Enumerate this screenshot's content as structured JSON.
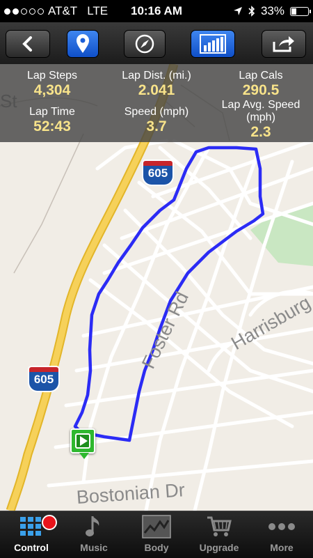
{
  "status_bar": {
    "carrier": "AT&T",
    "network": "LTE",
    "time": "10:16 AM",
    "battery": "33%",
    "battery_level": 0.33,
    "signal_bars_filled": 2,
    "signal_bars_total": 5
  },
  "toolbar": {
    "buttons": [
      {
        "name": "back",
        "icon": "chevron-left-icon"
      },
      {
        "name": "location",
        "icon": "map-pin-icon",
        "active": true
      },
      {
        "name": "compass",
        "icon": "compass-icon"
      },
      {
        "name": "stats",
        "icon": "bar-chart-icon",
        "active": true
      },
      {
        "name": "share",
        "icon": "share-arrow-icon"
      }
    ]
  },
  "stats": {
    "lap_steps_label": "Lap Steps",
    "lap_steps_value": "4,304",
    "lap_dist_label": "Lap Dist. (mi.)",
    "lap_dist_value": "2.041",
    "lap_cals_label": "Lap Cals",
    "lap_cals_value": "290.5",
    "lap_time_label": "Lap Time",
    "lap_time_value": "52:43",
    "speed_label": "Speed (mph)",
    "speed_value": "3.7",
    "lap_avg_speed_label": "Lap Avg. Speed (mph)",
    "lap_avg_speed_value": "2.3"
  },
  "map": {
    "highway_shield_1": "605",
    "highway_shield_2": "605",
    "street_foster": "Foster Rd",
    "street_harrisburg": "Harrisburg",
    "street_bostonian": "Bostonian Dr",
    "street_st": "St",
    "route_color": "#2b2bf5",
    "highway_color": "#f4c63d"
  },
  "tabbar": {
    "tabs": [
      {
        "label": "Control",
        "icon": "grid-icon",
        "active": true
      },
      {
        "label": "Music",
        "icon": "music-note-icon"
      },
      {
        "label": "Body",
        "icon": "body-chart-icon"
      },
      {
        "label": "Upgrade",
        "icon": "shopping-cart-icon"
      },
      {
        "label": "More",
        "icon": "more-dots-icon"
      }
    ]
  }
}
